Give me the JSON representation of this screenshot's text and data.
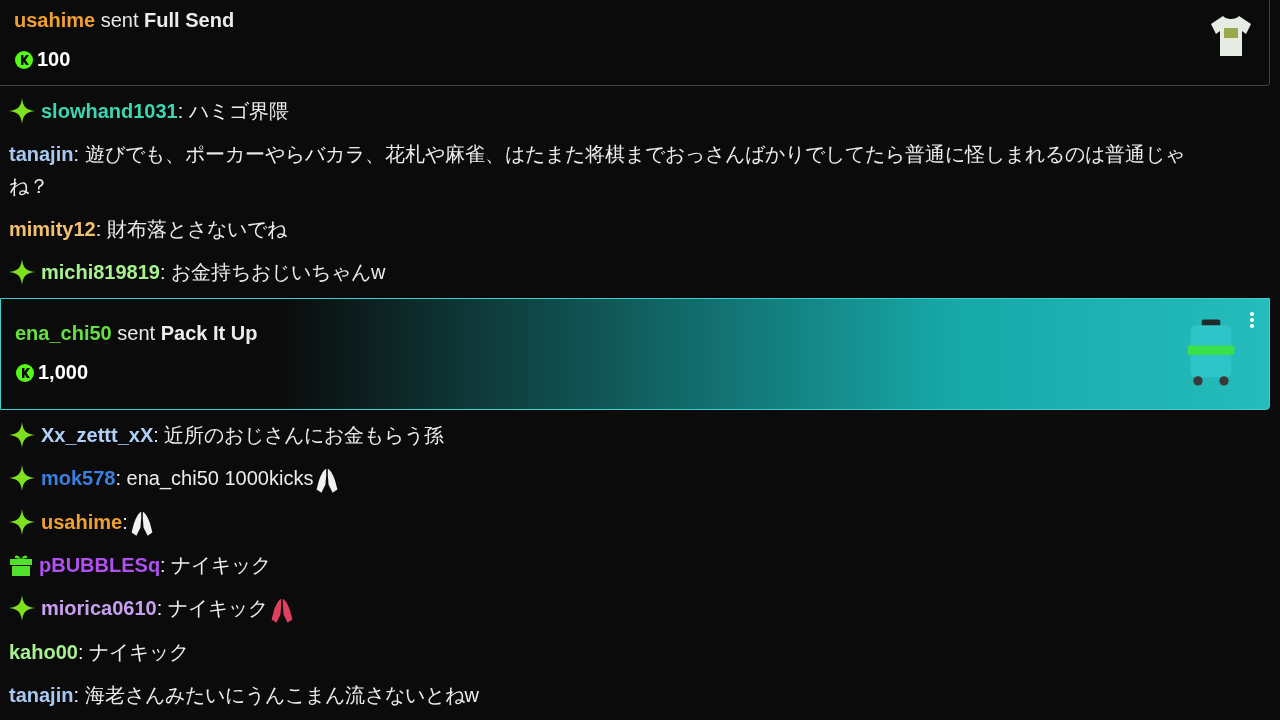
{
  "messages": [
    {
      "kind": "gift",
      "username": "usahime",
      "color": "#f0a030",
      "verb": "sent",
      "item": "Full Send",
      "amount": "100",
      "highlighted": false
    },
    {
      "kind": "sparkle",
      "username": "slowhand1031",
      "color": "#3dd6b0",
      "text": ": ハミゴ界隈",
      "emote": false
    },
    {
      "kind": "plain",
      "username": "tanajin",
      "color": "#a9c8f0",
      "text": ": 遊びでも、ポーカーやらバカラ、花札や麻雀、はたまた将棋までおっさんばかりでしてたら普通に怪しまれるのは普通じゃね？",
      "emote": false
    },
    {
      "kind": "plain",
      "username": "mimity12",
      "color": "#f0c070",
      "text": ": 財布落とさないでね",
      "emote": false
    },
    {
      "kind": "sparkle",
      "username": "michi819819",
      "color": "#a8f090",
      "text": ": お金持ちおじいちゃんw",
      "emote": false
    },
    {
      "kind": "gift",
      "username": "ena_chi50",
      "color": "#66e040",
      "verb": "sent",
      "item": "Pack It Up",
      "amount": "1,000",
      "highlighted": true
    },
    {
      "kind": "sparkle",
      "username": "Xx_zettt_xX",
      "color": "#b0d0f8",
      "text": ": 近所のおじさんにお金もらう孫",
      "emote": false
    },
    {
      "kind": "sparkle",
      "username": "mok578",
      "color": "#3a80e0",
      "text": ": ena_chi50 1000kicks",
      "emote": true
    },
    {
      "kind": "sparkle",
      "username": "usahime",
      "color": "#f0a030",
      "text": ":",
      "emote": true
    },
    {
      "kind": "gifter",
      "username": "pBUBBLESq",
      "color": "#b050f0",
      "text": ": ナイキック",
      "emote": false
    },
    {
      "kind": "sparkle",
      "username": "miorica0610",
      "color": "#c8a0f0",
      "text": ": ナイキック",
      "emote": true
    },
    {
      "kind": "plain",
      "username": "kaho00",
      "color": "#a8f090",
      "text": ": ナイキック",
      "emote": false
    },
    {
      "kind": "plain",
      "username": "tanajin",
      "color": "#a9c8f0",
      "text": ": 海老さんみたいにうんこまん流さないとねw",
      "emote": false
    }
  ]
}
